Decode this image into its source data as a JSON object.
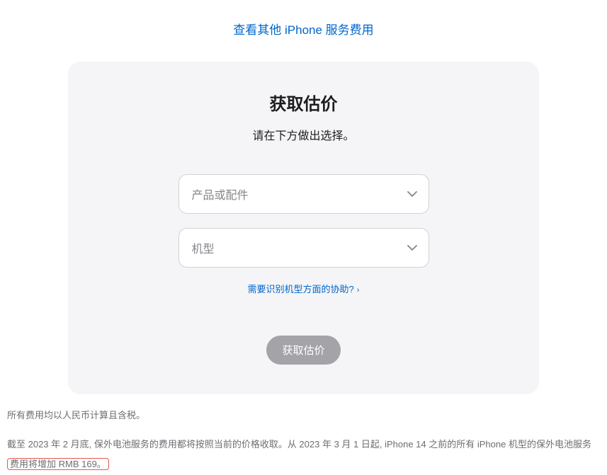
{
  "topLink": "查看其他 iPhone 服务费用",
  "card": {
    "title": "获取估价",
    "subtitle": "请在下方做出选择。",
    "select1Placeholder": "产品或配件",
    "select2Placeholder": "机型",
    "helpLink": "需要识别机型方面的协助?",
    "submitLabel": "获取估价"
  },
  "footer": {
    "line1": "所有费用均以人民币计算且含税。",
    "line2_part1": "截至 2023 年 2 月底, 保外电池服务的费用都将按照当前的价格收取。从 2023 年 3 月 1 日起, iPhone 14 之前的所有 iPhone 机型的保外电池服务",
    "line2_highlight": "费用将增加 RMB 169。"
  }
}
